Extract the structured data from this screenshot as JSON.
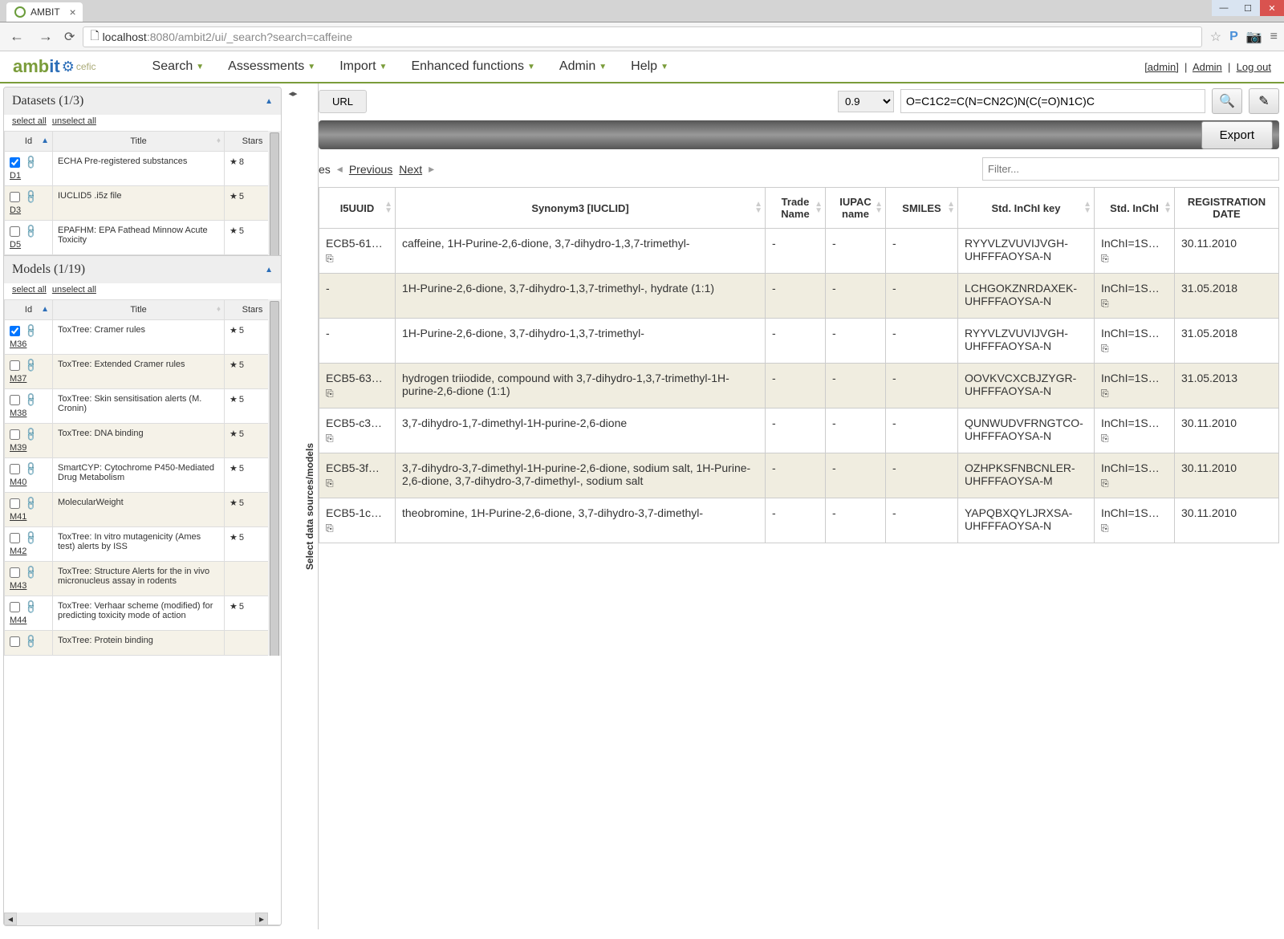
{
  "browser": {
    "tab_title": "AMBIT",
    "url_host": "localhost",
    "url_port": ":8080",
    "url_path": "/ambit2/ui/_search?search=caffeine"
  },
  "header": {
    "logo_a": "amb",
    "logo_b": "it",
    "logo_cefic": "cefic",
    "menu": [
      "Search",
      "Assessments",
      "Import",
      "Enhanced functions",
      "Admin",
      "Help"
    ],
    "right": {
      "admin_brackets": "[admin]",
      "admin": "Admin",
      "logout": "Log out"
    }
  },
  "sidebar": {
    "datasets": {
      "title": "Datasets (1/3)",
      "select_all": "select all",
      "unselect_all": "unselect all",
      "columns": [
        "Id",
        "Title",
        "Stars"
      ],
      "rows": [
        {
          "id": "D1",
          "checked": true,
          "title": "ECHA Pre-registered substances",
          "stars": "8"
        },
        {
          "id": "D3",
          "checked": false,
          "title": "IUCLID5 .i5z file",
          "stars": "5"
        },
        {
          "id": "D5",
          "checked": false,
          "title": "EPAFHM: EPA Fathead Minnow Acute Toxicity",
          "stars": "5"
        }
      ]
    },
    "models": {
      "title": "Models (1/19)",
      "select_all": "select all",
      "unselect_all": "unselect all",
      "columns": [
        "Id",
        "Title",
        "Stars"
      ],
      "rows": [
        {
          "id": "M36",
          "checked": true,
          "title": "ToxTree: Cramer rules",
          "stars": "5"
        },
        {
          "id": "M37",
          "checked": false,
          "title": "ToxTree: Extended Cramer rules",
          "stars": "5"
        },
        {
          "id": "M38",
          "checked": false,
          "title": "ToxTree: Skin sensitisation alerts (M. Cronin)",
          "stars": "5"
        },
        {
          "id": "M39",
          "checked": false,
          "title": "ToxTree: DNA binding",
          "stars": "5"
        },
        {
          "id": "M40",
          "checked": false,
          "title": "SmartCYP: Cytochrome P450-Mediated Drug Metabolism",
          "stars": "5"
        },
        {
          "id": "M41",
          "checked": false,
          "title": "MolecularWeight",
          "stars": "5"
        },
        {
          "id": "M42",
          "checked": false,
          "title": "ToxTree: In vitro mutagenicity (Ames test) alerts by ISS",
          "stars": "5"
        },
        {
          "id": "M43",
          "checked": false,
          "title": "ToxTree: Structure Alerts for the in vivo micronucleus assay in rodents",
          "stars": ""
        },
        {
          "id": "M44",
          "checked": false,
          "title": "ToxTree: Verhaar scheme (modified) for predicting toxicity mode of action",
          "stars": "5"
        },
        {
          "id": "",
          "checked": false,
          "title": "ToxTree: Protein binding",
          "stars": ""
        }
      ]
    },
    "vert_label": "Select data sources/models"
  },
  "main": {
    "url_button": "URL",
    "threshold": "0.9",
    "smiles": "O=C1C2=C(N=CN2C)N(C(=O)N1C)C",
    "export": "Export",
    "pager_es": "es",
    "prev": "Previous",
    "next": "Next",
    "filter_placeholder": "Filter...",
    "columns": [
      "I5UUID",
      "Synonym3 [IUCLID]",
      "Trade Name",
      "IUPAC name",
      "SMILES",
      "Std. InChI key",
      "Std. InChI",
      "REGISTRATION DATE"
    ],
    "rows": [
      {
        "i5": "ECB5-61…",
        "syn": "caffeine, 1H-Purine-2,6-dione, 3,7-dihydro-1,3,7-trimethyl-",
        "trade": "-",
        "iupac": "-",
        "smiles": "-",
        "inchikey": "RYYVLZVUVIJVGH-UHFFFAOYSA-N",
        "inchi": "InChI=1S…",
        "date": "30.11.2010"
      },
      {
        "i5": "-",
        "syn": "1H-Purine-2,6-dione, 3,7-dihydro-1,3,7-trimethyl-, hydrate (1:1)",
        "trade": "-",
        "iupac": "-",
        "smiles": "-",
        "inchikey": "LCHGOKZNRDAXEK-UHFFFAOYSA-N",
        "inchi": "InChI=1S…",
        "date": "31.05.2018"
      },
      {
        "i5": "-",
        "syn": "1H-Purine-2,6-dione, 3,7-dihydro-1,3,7-trimethyl-",
        "trade": "-",
        "iupac": "-",
        "smiles": "-",
        "inchikey": "RYYVLZVUVIJVGH-UHFFFAOYSA-N",
        "inchi": "InChI=1S…",
        "date": "31.05.2018"
      },
      {
        "i5": "ECB5-63…",
        "syn": "hydrogen triiodide, compound with 3,7-dihydro-1,3,7-trimethyl-1H-purine-2,6-dione (1:1)",
        "trade": "-",
        "iupac": "-",
        "smiles": "-",
        "inchikey": "OOVKVCXCBJZYGR-UHFFFAOYSA-N",
        "inchi": "InChI=1S…",
        "date": "31.05.2013"
      },
      {
        "i5": "ECB5-c3…",
        "syn": "3,7-dihydro-1,7-dimethyl-1H-purine-2,6-dione",
        "trade": "-",
        "iupac": "-",
        "smiles": "-",
        "inchikey": "QUNWUDVFRNGTCO-UHFFFAOYSA-N",
        "inchi": "InChI=1S…",
        "date": "30.11.2010"
      },
      {
        "i5": "ECB5-3f…",
        "syn": "3,7-dihydro-3,7-dimethyl-1H-purine-2,6-dione, sodium salt, 1H-Purine-2,6-dione, 3,7-dihydro-3,7-dimethyl-, sodium salt",
        "trade": "-",
        "iupac": "-",
        "smiles": "-",
        "inchikey": "OZHPKSFNBCNLER-UHFFFAOYSA-M",
        "inchi": "InChI=1S…",
        "date": "30.11.2010"
      },
      {
        "i5": "ECB5-1c…",
        "syn": "theobromine, 1H-Purine-2,6-dione, 3,7-dihydro-3,7-dimethyl-",
        "trade": "-",
        "iupac": "-",
        "smiles": "-",
        "inchikey": "YAPQBXQYLJRXSA-UHFFFAOYSA-N",
        "inchi": "InChI=1S…",
        "date": "30.11.2010"
      }
    ]
  }
}
